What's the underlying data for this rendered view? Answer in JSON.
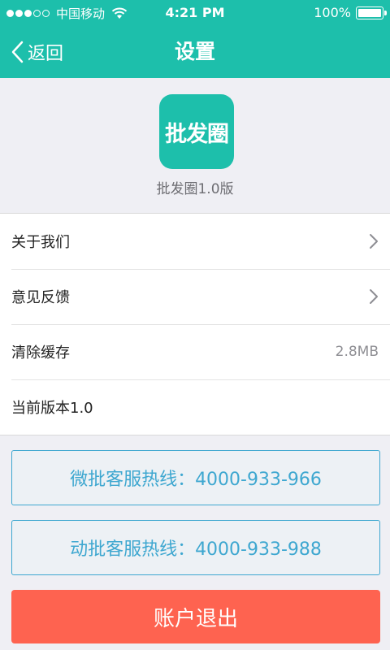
{
  "status_bar": {
    "carrier": "中国移动",
    "time": "4:21 PM",
    "battery": "100%",
    "signal_strength": 3,
    "icons": [
      "signal-dots-icon",
      "wifi-icon",
      "battery-icon"
    ]
  },
  "nav": {
    "back_label": "返回",
    "title": "设置",
    "back_icon": "chevron-left-icon"
  },
  "app": {
    "logo_text": "批发圈",
    "version_label": "批发圈1.0版"
  },
  "settings": {
    "about": "关于我们",
    "feedback": "意见反馈",
    "clear_cache": "清除缓存",
    "cache_size": "2.8MB",
    "current_version": "当前版本1.0"
  },
  "hotlines": {
    "weipi": "微批客服热线：4000-933-966",
    "dongpi": "动批客服热线：4000-933-988"
  },
  "logout_label": "账户退出",
  "colors": {
    "brand": "#1dbfab",
    "hotline": "#3ea7d0",
    "logout": "#fe6350",
    "background": "#efeff4"
  }
}
